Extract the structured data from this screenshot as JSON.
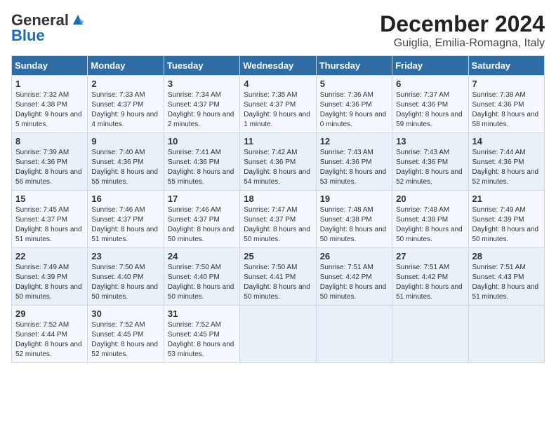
{
  "header": {
    "logo_general": "General",
    "logo_blue": "Blue",
    "month_title": "December 2024",
    "location": "Guiglia, Emilia-Romagna, Italy"
  },
  "weekdays": [
    "Sunday",
    "Monday",
    "Tuesday",
    "Wednesday",
    "Thursday",
    "Friday",
    "Saturday"
  ],
  "weeks": [
    [
      {
        "day": 1,
        "sunrise": "7:32 AM",
        "sunset": "4:38 PM",
        "daylight": "9 hours and 5 minutes."
      },
      {
        "day": 2,
        "sunrise": "7:33 AM",
        "sunset": "4:37 PM",
        "daylight": "9 hours and 4 minutes."
      },
      {
        "day": 3,
        "sunrise": "7:34 AM",
        "sunset": "4:37 PM",
        "daylight": "9 hours and 2 minutes."
      },
      {
        "day": 4,
        "sunrise": "7:35 AM",
        "sunset": "4:37 PM",
        "daylight": "9 hours and 1 minute."
      },
      {
        "day": 5,
        "sunrise": "7:36 AM",
        "sunset": "4:36 PM",
        "daylight": "9 hours and 0 minutes."
      },
      {
        "day": 6,
        "sunrise": "7:37 AM",
        "sunset": "4:36 PM",
        "daylight": "8 hours and 59 minutes."
      },
      {
        "day": 7,
        "sunrise": "7:38 AM",
        "sunset": "4:36 PM",
        "daylight": "8 hours and 58 minutes."
      }
    ],
    [
      {
        "day": 8,
        "sunrise": "7:39 AM",
        "sunset": "4:36 PM",
        "daylight": "8 hours and 56 minutes."
      },
      {
        "day": 9,
        "sunrise": "7:40 AM",
        "sunset": "4:36 PM",
        "daylight": "8 hours and 55 minutes."
      },
      {
        "day": 10,
        "sunrise": "7:41 AM",
        "sunset": "4:36 PM",
        "daylight": "8 hours and 55 minutes."
      },
      {
        "day": 11,
        "sunrise": "7:42 AM",
        "sunset": "4:36 PM",
        "daylight": "8 hours and 54 minutes."
      },
      {
        "day": 12,
        "sunrise": "7:43 AM",
        "sunset": "4:36 PM",
        "daylight": "8 hours and 53 minutes."
      },
      {
        "day": 13,
        "sunrise": "7:43 AM",
        "sunset": "4:36 PM",
        "daylight": "8 hours and 52 minutes."
      },
      {
        "day": 14,
        "sunrise": "7:44 AM",
        "sunset": "4:36 PM",
        "daylight": "8 hours and 52 minutes."
      }
    ],
    [
      {
        "day": 15,
        "sunrise": "7:45 AM",
        "sunset": "4:37 PM",
        "daylight": "8 hours and 51 minutes."
      },
      {
        "day": 16,
        "sunrise": "7:46 AM",
        "sunset": "4:37 PM",
        "daylight": "8 hours and 51 minutes."
      },
      {
        "day": 17,
        "sunrise": "7:46 AM",
        "sunset": "4:37 PM",
        "daylight": "8 hours and 50 minutes."
      },
      {
        "day": 18,
        "sunrise": "7:47 AM",
        "sunset": "4:37 PM",
        "daylight": "8 hours and 50 minutes."
      },
      {
        "day": 19,
        "sunrise": "7:48 AM",
        "sunset": "4:38 PM",
        "daylight": "8 hours and 50 minutes."
      },
      {
        "day": 20,
        "sunrise": "7:48 AM",
        "sunset": "4:38 PM",
        "daylight": "8 hours and 50 minutes."
      },
      {
        "day": 21,
        "sunrise": "7:49 AM",
        "sunset": "4:39 PM",
        "daylight": "8 hours and 50 minutes."
      }
    ],
    [
      {
        "day": 22,
        "sunrise": "7:49 AM",
        "sunset": "4:39 PM",
        "daylight": "8 hours and 50 minutes."
      },
      {
        "day": 23,
        "sunrise": "7:50 AM",
        "sunset": "4:40 PM",
        "daylight": "8 hours and 50 minutes."
      },
      {
        "day": 24,
        "sunrise": "7:50 AM",
        "sunset": "4:40 PM",
        "daylight": "8 hours and 50 minutes."
      },
      {
        "day": 25,
        "sunrise": "7:50 AM",
        "sunset": "4:41 PM",
        "daylight": "8 hours and 50 minutes."
      },
      {
        "day": 26,
        "sunrise": "7:51 AM",
        "sunset": "4:42 PM",
        "daylight": "8 hours and 50 minutes."
      },
      {
        "day": 27,
        "sunrise": "7:51 AM",
        "sunset": "4:42 PM",
        "daylight": "8 hours and 51 minutes."
      },
      {
        "day": 28,
        "sunrise": "7:51 AM",
        "sunset": "4:43 PM",
        "daylight": "8 hours and 51 minutes."
      }
    ],
    [
      {
        "day": 29,
        "sunrise": "7:52 AM",
        "sunset": "4:44 PM",
        "daylight": "8 hours and 52 minutes."
      },
      {
        "day": 30,
        "sunrise": "7:52 AM",
        "sunset": "4:45 PM",
        "daylight": "8 hours and 52 minutes."
      },
      {
        "day": 31,
        "sunrise": "7:52 AM",
        "sunset": "4:45 PM",
        "daylight": "8 hours and 53 minutes."
      },
      null,
      null,
      null,
      null
    ]
  ]
}
